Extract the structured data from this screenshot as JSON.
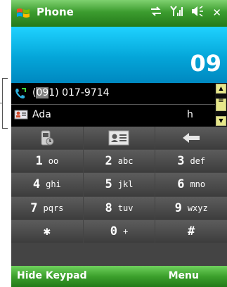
{
  "title_bar": {
    "app_title": "Phone",
    "icons": [
      "windows-start-icon",
      "connectivity-icon",
      "signal-icon",
      "speaker-icon",
      "close-icon"
    ],
    "close_label": "✕"
  },
  "display": {
    "dialed_number": "09"
  },
  "matches": [
    {
      "icon": "phone-call-icon",
      "pre": "(",
      "highlight": "09",
      "post": "1) 017-9714",
      "badge": ""
    },
    {
      "icon": "contact-card-icon",
      "pre": "",
      "highlight": "",
      "post": "Ada",
      "badge": "h"
    }
  ],
  "keypad": {
    "top_row": [
      "call-history-icon",
      "contacts-icon",
      "backspace-icon"
    ],
    "keys": [
      {
        "digit": "1",
        "letters": "oo"
      },
      {
        "digit": "2",
        "letters": "abc"
      },
      {
        "digit": "3",
        "letters": "def"
      },
      {
        "digit": "4",
        "letters": "ghi"
      },
      {
        "digit": "5",
        "letters": "jkl"
      },
      {
        "digit": "6",
        "letters": "mno"
      },
      {
        "digit": "7",
        "letters": "pqrs"
      },
      {
        "digit": "8",
        "letters": "tuv"
      },
      {
        "digit": "9",
        "letters": "wxyz"
      },
      {
        "digit": "✱",
        "letters": ""
      },
      {
        "digit": "0",
        "letters": "+"
      },
      {
        "digit": "#",
        "letters": ""
      }
    ]
  },
  "softkeys": {
    "left": "Hide Keypad",
    "right": "Menu"
  },
  "colors": {
    "title_green": "#3c9c2f",
    "display_blue": "#04a5d8",
    "key_gray": "#4a4a4a"
  }
}
